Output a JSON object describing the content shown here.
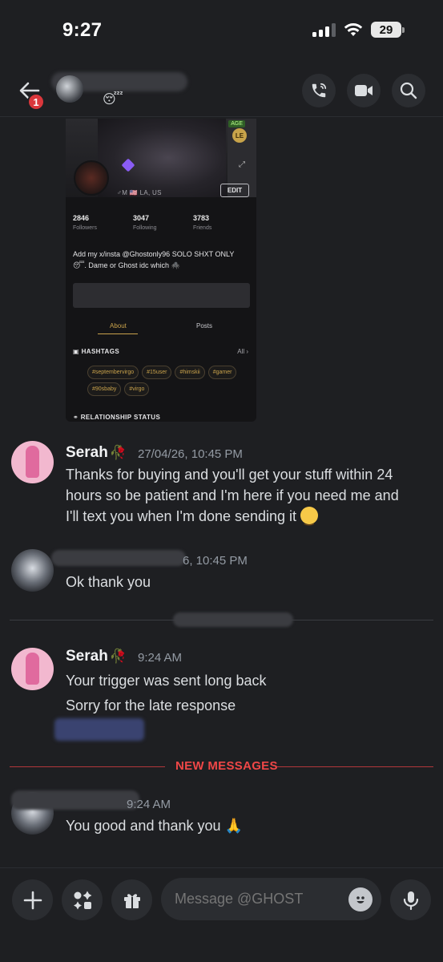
{
  "status_bar": {
    "time": "9:27",
    "battery": "29"
  },
  "header": {
    "notification_count": "1",
    "emoji": "😴"
  },
  "profile_card": {
    "location": "♂M  🇺🇸 LA, US",
    "age_tag": "AGE",
    "level_badge": "LE",
    "edit_label": "EDIT",
    "stats": [
      {
        "value": "2846",
        "label": "Followers"
      },
      {
        "value": "3047",
        "label": "Following"
      },
      {
        "value": "3783",
        "label": "Friends"
      }
    ],
    "bio": "Add my x/insta @Ghostonly96 SOLO SHXT ONLY 😴. Dame or Ghost idc which 🕷️",
    "tabs": [
      "About",
      "Posts"
    ],
    "hashtags_title": "HASHTAGS",
    "all_label": "All",
    "hashtags": [
      "#septembervirgo",
      "#15user",
      "#himskii",
      "#gamer",
      "#90sbaby",
      "#virgo"
    ],
    "relationship_title": "RELATIONSHIP STATUS"
  },
  "messages": [
    {
      "author": "Serah",
      "timestamp": "27/04/26, 10:45 PM",
      "lines": [
        "Thanks for buying and you'll get your stuff within 24",
        "hours so be patient and I'm here if you need me and",
        "I'll text you when I'm done sending it"
      ]
    },
    {
      "timestamp": "6, 10:45 PM",
      "text": "Ok thank you"
    },
    {
      "author": "Serah",
      "timestamp": "9:24 AM",
      "lines": [
        "Your trigger was sent long back",
        "Sorry for the late response"
      ]
    },
    {
      "timestamp": "9:24 AM",
      "text": "You good and thank you"
    }
  ],
  "new_messages_label": "NEW MESSAGES",
  "composer": {
    "placeholder": "Message @GHOST"
  }
}
